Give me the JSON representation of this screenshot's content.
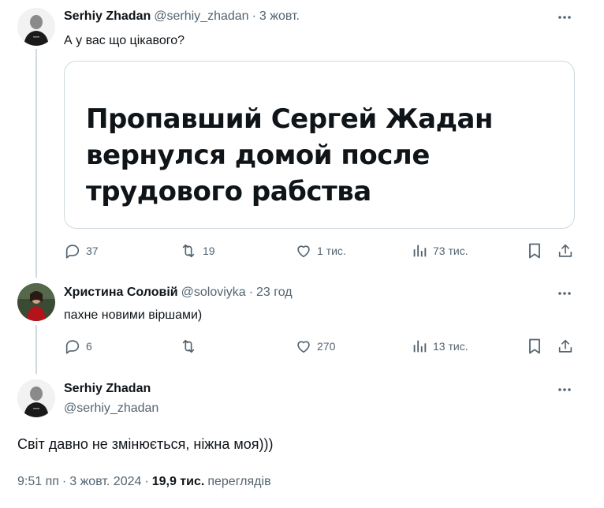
{
  "post": {
    "author": "Serhiy Zhadan",
    "handle": "@serhiy_zhadan",
    "separator": "·",
    "date": "3 жовт.",
    "text": "А у вас що цікавого?",
    "card_lines": [
      "Пропавший Сергей Жадан",
      "вернулся домой после",
      "трудового рабства"
    ],
    "replies": "37",
    "reposts": "19",
    "likes": "1 тис.",
    "views": "73 тис."
  },
  "reply": {
    "author": "Христина Соловій",
    "handle": "@soloviyka",
    "separator": "·",
    "date": "23 год",
    "text": "пахне новими віршами)",
    "replies": "6",
    "reposts": "",
    "likes": "270",
    "views": "13 тис."
  },
  "main": {
    "author": "Serhiy Zhadan",
    "handle": "@serhiy_zhadan",
    "text": "Світ давно не змінюється, ніжна моя)))",
    "time": "9:51 пп",
    "separator": "·",
    "date": "3 жовт. 2024",
    "separator2": "·",
    "views_count": "19,9 тис.",
    "views_label": "переглядів"
  },
  "colors": {
    "text": "#0f1419",
    "secondary": "#536471",
    "border": "#cfd9de"
  },
  "icons": [
    "more-icon",
    "reply-icon",
    "repost-icon",
    "like-icon",
    "views-icon",
    "bookmark-icon",
    "share-icon"
  ]
}
